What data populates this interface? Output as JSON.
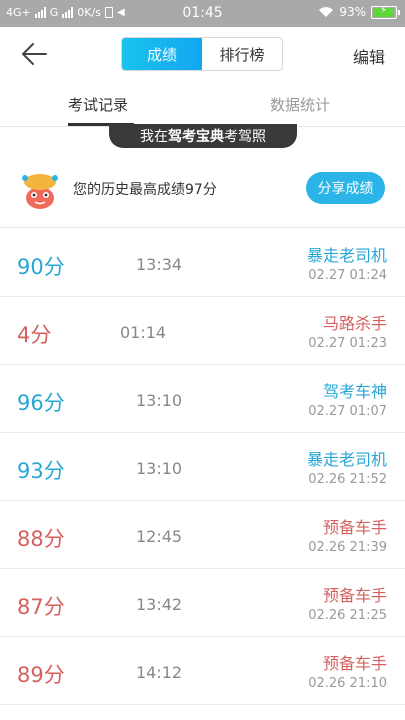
{
  "status_bar": {
    "network": "4G+",
    "carrier2": "G",
    "speed": "0K/s",
    "time": "01:45",
    "battery": "93%"
  },
  "header": {
    "segments": [
      "成绩",
      "排行榜"
    ],
    "edit_label": "编辑"
  },
  "tabs": [
    "考试记录",
    "数据统计"
  ],
  "banner": {
    "prefix": "我在",
    "brand": "驾考宝典",
    "suffix": "考驾照"
  },
  "best": {
    "text": "您的历史最高成绩97分",
    "share_label": "分享成绩"
  },
  "records": [
    {
      "score": "90分",
      "duration": "13:34",
      "title": "暴走老司机",
      "date": "02.27  01:24",
      "color": "#2aa6d6"
    },
    {
      "score": "4分",
      "duration": "01:14",
      "title": "马路杀手",
      "date": "02.27  01:23",
      "color": "#d5615e"
    },
    {
      "score": "96分",
      "duration": "13:10",
      "title": "驾考车神",
      "date": "02.27  01:07",
      "color": "#2aa6d6"
    },
    {
      "score": "93分",
      "duration": "13:10",
      "title": "暴走老司机",
      "date": "02.26  21:52",
      "color": "#2aa6d6"
    },
    {
      "score": "88分",
      "duration": "12:45",
      "title": "预备车手",
      "date": "02.26  21:39",
      "color": "#d5615e"
    },
    {
      "score": "87分",
      "duration": "13:42",
      "title": "预备车手",
      "date": "02.26  21:25",
      "color": "#d5615e"
    },
    {
      "score": "89分",
      "duration": "14:12",
      "title": "预备车手",
      "date": "02.26  21:10",
      "color": "#d5615e"
    }
  ]
}
